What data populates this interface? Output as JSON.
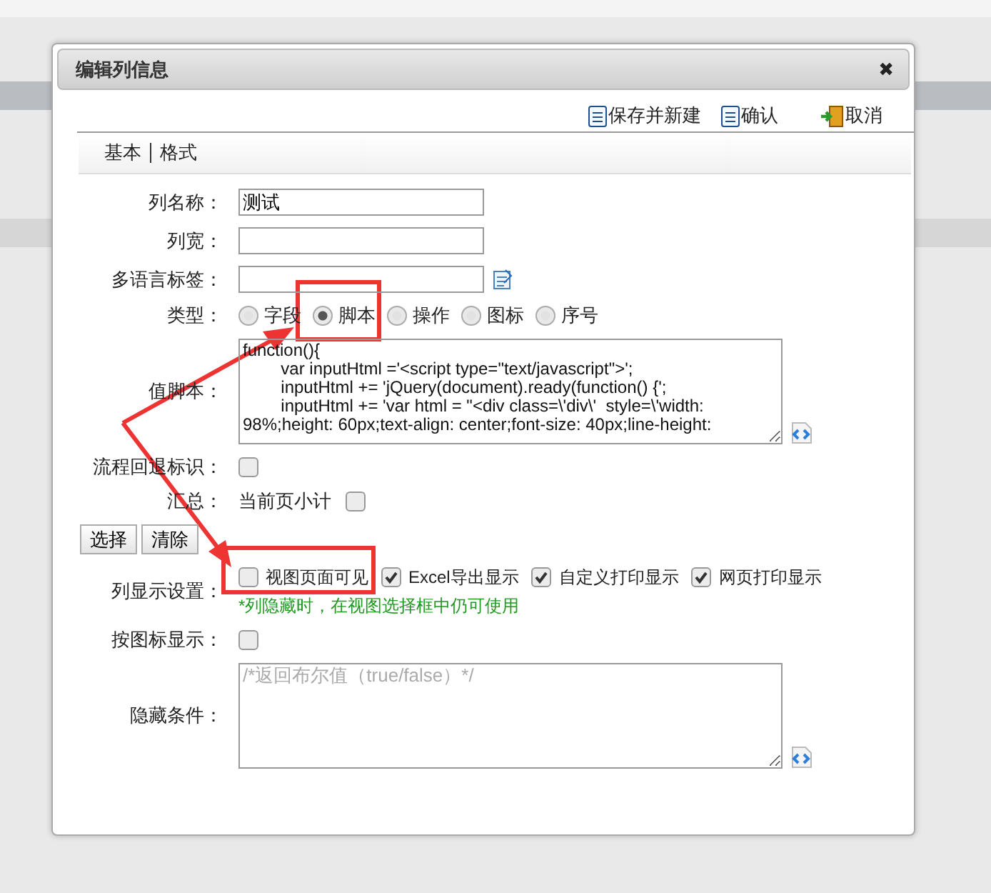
{
  "window": {
    "title": "编辑列信息",
    "close": "✖"
  },
  "toolbar": [
    {
      "label": "保存并新建",
      "kind": "save"
    },
    {
      "label": "确认",
      "kind": "save"
    },
    {
      "label": "取消",
      "kind": "exit"
    }
  ],
  "tabs": [
    {
      "label": "基本",
      "selected": false
    },
    {
      "label": "格式",
      "selected": false
    }
  ],
  "form": {
    "name": {
      "label": "列名称：",
      "value": "测试"
    },
    "width": {
      "label": "列宽："
    },
    "lang_label": {
      "label": "多语言标签："
    },
    "type": {
      "label": "类型：",
      "options": [
        {
          "label": "字段",
          "selected": false
        },
        {
          "label": "脚本",
          "selected": true
        },
        {
          "label": "操作",
          "selected": false
        },
        {
          "label": "图标",
          "selected": false
        },
        {
          "label": "序号",
          "selected": false
        }
      ]
    },
    "script": {
      "label": "值脚本：",
      "value": "function(){\n\tvar inputHtml ='<script type=\"text/javascript\">';\n\tinputHtml += 'jQuery(document).ready(function() {';\n\tinputHtml += 'var html = \"<div class=\\'div\\'  style=\\'width: 98%;height: 60px;text-align: center;font-size: 40px;line-height:"
    },
    "rollback": {
      "label": "流程回退标识：",
      "checked": false
    },
    "summary": {
      "label": "汇总：",
      "option": "当前页小计",
      "checked": false
    },
    "buttons": [
      "选择",
      "清除"
    ],
    "display": {
      "label": "列显示设置：",
      "options": [
        {
          "label": "视图页面可见",
          "checked": false
        },
        {
          "label": "Excel导出显示",
          "checked": true
        },
        {
          "label": "自定义打印显示",
          "checked": true
        },
        {
          "label": "网页打印显示",
          "checked": true
        }
      ],
      "hint": "*列隐藏时，在视图选择框中仍可使用"
    },
    "icon_display": {
      "label": "按图标显示：",
      "checked": false
    },
    "hide_condition": {
      "label": "隐藏条件：",
      "placeholder": "/*返回布尔值（true/false）*/"
    }
  }
}
